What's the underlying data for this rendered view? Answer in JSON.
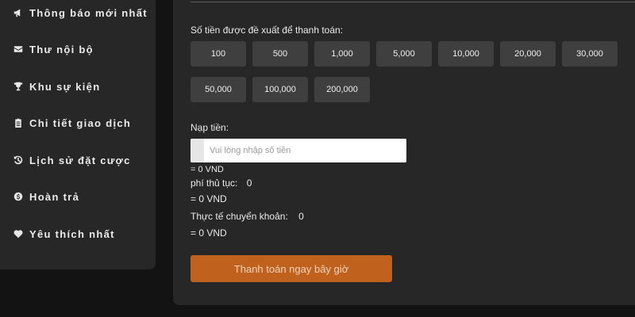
{
  "sidebar": {
    "items": [
      {
        "label": "Thông báo mới nhất",
        "icon": "megaphone-icon"
      },
      {
        "label": "Thư nội bộ",
        "icon": "envelope-icon"
      },
      {
        "label": "Khu sự kiện",
        "icon": "trophy-icon"
      },
      {
        "label": "Chi tiết giao dịch",
        "icon": "clipboard-icon"
      },
      {
        "label": "Lịch sử đặt cược",
        "icon": "history-icon"
      },
      {
        "label": "Hoàn trả",
        "icon": "dollar-coin-icon"
      },
      {
        "label": "Yêu thích nhất",
        "icon": "heart-icon"
      }
    ]
  },
  "main": {
    "suggested_label": "Số tiền được đề xuất để thanh toán:",
    "amounts": [
      "100",
      "500",
      "1,000",
      "5,000",
      "10,000",
      "20,000",
      "30,000",
      "50,000",
      "100,000",
      "200,000"
    ],
    "deposit_label": "Nạp tiền:",
    "input_placeholder": "Vui lòng nhập số tiền",
    "converted": "= 0 VND",
    "fee_label": "phí thủ tục:",
    "fee_value": "0",
    "fee_converted": "= 0 VND",
    "actual_label": "Thực tế chuyển khoản:",
    "actual_value": "0",
    "actual_converted": "= 0 VND",
    "pay_button": "Thanh toán ngay bây giờ"
  },
  "colors": {
    "background": "#131313",
    "panel": "#272727",
    "amount_button": "#3f3f3f",
    "accent": "#c0621d"
  }
}
